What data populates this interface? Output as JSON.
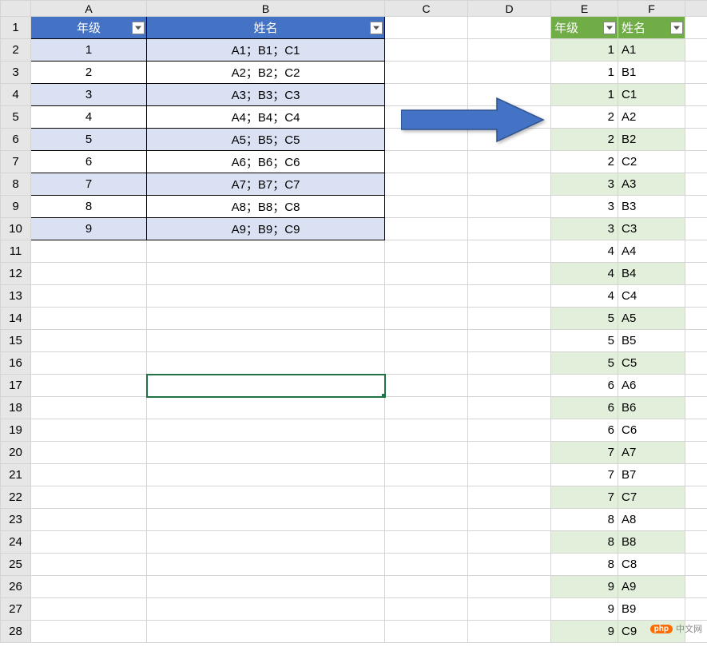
{
  "columns": [
    "A",
    "B",
    "C",
    "D",
    "E",
    "F"
  ],
  "left_table": {
    "headers": {
      "A": "年级",
      "B": "姓名"
    },
    "rows": [
      {
        "grade": "1",
        "names": "A1；B1；C1"
      },
      {
        "grade": "2",
        "names": "A2；B2；C2"
      },
      {
        "grade": "3",
        "names": "A3；B3；C3"
      },
      {
        "grade": "4",
        "names": "A4；B4；C4"
      },
      {
        "grade": "5",
        "names": "A5；B5；C5"
      },
      {
        "grade": "6",
        "names": "A6；B6；C6"
      },
      {
        "grade": "7",
        "names": "A7；B7；C7"
      },
      {
        "grade": "8",
        "names": "A8；B8；C8"
      },
      {
        "grade": "9",
        "names": "A9；B9；C9"
      }
    ]
  },
  "right_table": {
    "headers": {
      "E": "年级",
      "F": "姓名"
    },
    "rows": [
      {
        "grade": "1",
        "name": "A1"
      },
      {
        "grade": "1",
        "name": "B1"
      },
      {
        "grade": "1",
        "name": "C1"
      },
      {
        "grade": "2",
        "name": "A2"
      },
      {
        "grade": "2",
        "name": "B2"
      },
      {
        "grade": "2",
        "name": "C2"
      },
      {
        "grade": "3",
        "name": "A3"
      },
      {
        "grade": "3",
        "name": "B3"
      },
      {
        "grade": "3",
        "name": "C3"
      },
      {
        "grade": "4",
        "name": "A4"
      },
      {
        "grade": "4",
        "name": "B4"
      },
      {
        "grade": "4",
        "name": "C4"
      },
      {
        "grade": "5",
        "name": "A5"
      },
      {
        "grade": "5",
        "name": "B5"
      },
      {
        "grade": "5",
        "name": "C5"
      },
      {
        "grade": "6",
        "name": "A6"
      },
      {
        "grade": "6",
        "name": "B6"
      },
      {
        "grade": "6",
        "name": "C6"
      },
      {
        "grade": "7",
        "name": "A7"
      },
      {
        "grade": "7",
        "name": "B7"
      },
      {
        "grade": "7",
        "name": "C7"
      },
      {
        "grade": "8",
        "name": "A8"
      },
      {
        "grade": "8",
        "name": "B8"
      },
      {
        "grade": "8",
        "name": "C8"
      },
      {
        "grade": "9",
        "name": "A9"
      },
      {
        "grade": "9",
        "name": "B9"
      },
      {
        "grade": "9",
        "name": "C9"
      }
    ]
  },
  "active_cell": "B17",
  "row_count": 28,
  "watermark": {
    "badge": "php",
    "text": "中文网"
  }
}
